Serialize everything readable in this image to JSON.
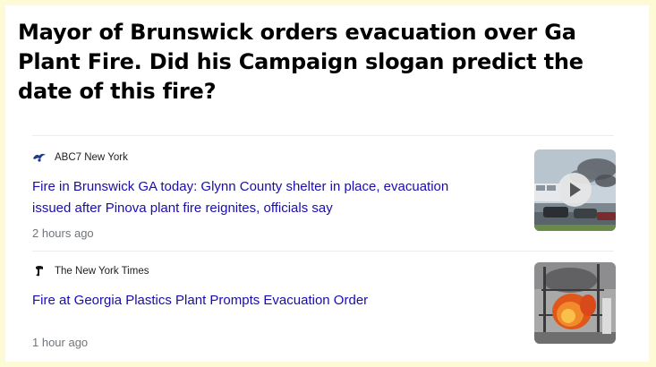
{
  "headline": "Mayor of Brunswick orders evacuation over Ga Plant Fire. Did his Campaign slogan predict the date of this fire?",
  "articles": [
    {
      "source": "ABC7 New York",
      "source_icon": "abc7-logo-icon",
      "title": "Fire in Brunswick GA today: Glynn County shelter in place, evacuation issued after Pinova plant fire reignites, officials say",
      "time": "2 hours ago",
      "thumbnail": "video-thumbnail-with-play-icon"
    },
    {
      "source": "The New York Times",
      "source_icon": "nyt-logo-icon",
      "title": "Fire at Georgia Plastics Plant Prompts Evacuation Order",
      "time": "1 hour ago",
      "thumbnail": "fire-image-thumbnail"
    }
  ],
  "colors": {
    "page_background": "#fdfbd6",
    "card_background": "#ffffff",
    "link": "#1a0dab",
    "meta_text": "#70757a"
  }
}
